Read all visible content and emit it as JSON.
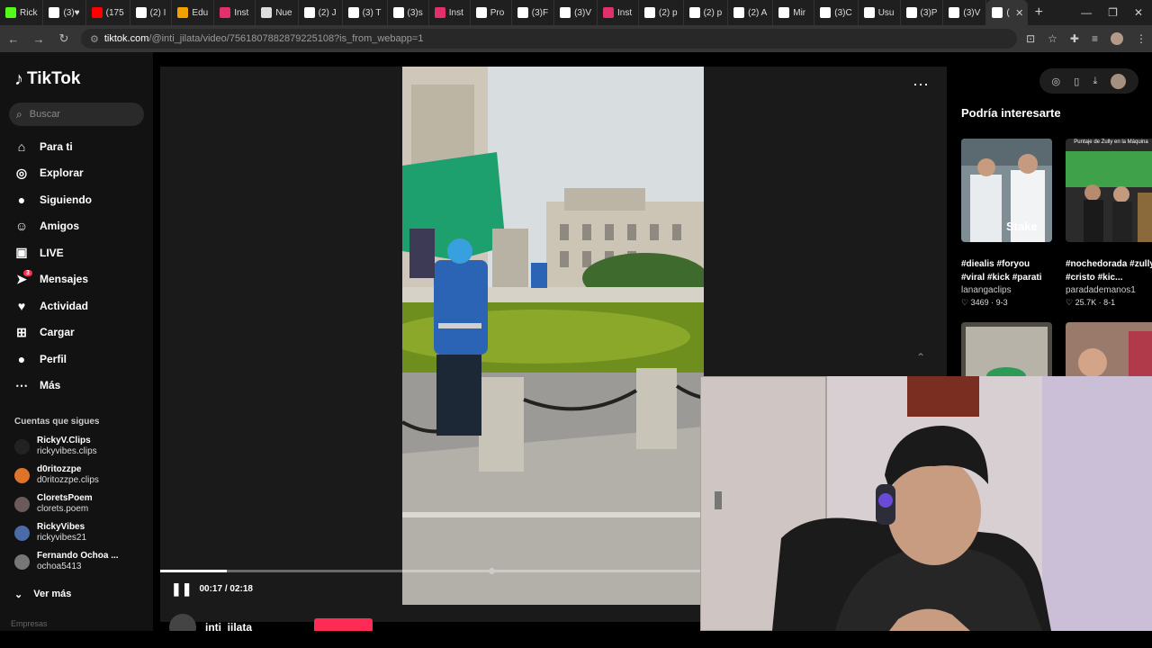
{
  "browser": {
    "tabs": [
      {
        "label": "Rick",
        "color": "#53fc18"
      },
      {
        "label": "(3)♥",
        "color": "#ffffff"
      },
      {
        "label": "(175",
        "color": "#ff0000"
      },
      {
        "label": "(2) I",
        "color": "#ffffff"
      },
      {
        "label": "Edu",
        "color": "#f4a100"
      },
      {
        "label": "Inst",
        "color": "#e1306c"
      },
      {
        "label": "Nue",
        "color": "#dddddd"
      },
      {
        "label": "(2) J",
        "color": "#ffffff"
      },
      {
        "label": "(3) T",
        "color": "#ffffff"
      },
      {
        "label": "(3)s",
        "color": "#ffffff"
      },
      {
        "label": "Inst",
        "color": "#e1306c"
      },
      {
        "label": "Pro",
        "color": "#ffffff"
      },
      {
        "label": "(3)F",
        "color": "#ffffff"
      },
      {
        "label": "(3)V",
        "color": "#ffffff"
      },
      {
        "label": "Inst",
        "color": "#e1306c"
      },
      {
        "label": "(2) p",
        "color": "#ffffff"
      },
      {
        "label": "(2) p",
        "color": "#ffffff"
      },
      {
        "label": "(2) A",
        "color": "#ffffff"
      },
      {
        "label": "Mir",
        "color": "#ffffff"
      },
      {
        "label": "(3)C",
        "color": "#ffffff"
      },
      {
        "label": "Usu",
        "color": "#ffffff"
      },
      {
        "label": "(3)P",
        "color": "#ffffff"
      },
      {
        "label": "(3)V",
        "color": "#ffffff"
      },
      {
        "label": "(",
        "color": "#ffffff",
        "active": true
      }
    ],
    "url_domain": "tiktok.com",
    "url_path": "/@inti_jilata/video/7561807882879225108?is_from_webapp=1"
  },
  "sidebar": {
    "logo": "TikTok",
    "search_placeholder": "Buscar",
    "nav": [
      {
        "label": "Para ti",
        "icon": "home-icon",
        "glyph": "⌂"
      },
      {
        "label": "Explorar",
        "icon": "compass-icon",
        "glyph": "◎"
      },
      {
        "label": "Siguiendo",
        "icon": "avatar-icon",
        "glyph": "●"
      },
      {
        "label": "Amigos",
        "icon": "friends-icon",
        "glyph": "☺"
      },
      {
        "label": "LIVE",
        "icon": "live-icon",
        "glyph": "▣"
      },
      {
        "label": "Mensajes",
        "icon": "messages-icon",
        "glyph": "➤",
        "badge": "3"
      },
      {
        "label": "Actividad",
        "icon": "activity-icon",
        "glyph": "♥"
      },
      {
        "label": "Cargar",
        "icon": "upload-icon",
        "glyph": "⊞"
      },
      {
        "label": "Perfil",
        "icon": "profile-icon",
        "glyph": "●"
      },
      {
        "label": "Más",
        "icon": "more-icon",
        "glyph": "⋯"
      }
    ],
    "following_title": "Cuentas que sigues",
    "following": [
      {
        "name": "RickyV.Clips",
        "handle": "rickyvibes.clips",
        "color": "#222222"
      },
      {
        "name": "d0ritozzpe",
        "handle": "d0ritozzpe.clips",
        "color": "#e0732a"
      },
      {
        "name": "CloretsPoem",
        "handle": "clorets.poem",
        "color": "#6a5a5a"
      },
      {
        "name": "RickyVibes",
        "handle": "rickyvibes21",
        "color": "#4a6aa8"
      },
      {
        "name": "Fernando Ochoa ...",
        "handle": "ochoa5413",
        "color": "#777777"
      }
    ],
    "see_more": "Ver más",
    "footer": "Empresas"
  },
  "player": {
    "time": "00:17 / 02:18",
    "progress": 0.123,
    "author": "inti_jilata"
  },
  "rail": {
    "title": "Podría interesarte",
    "cards": [
      {
        "caption": "#diealis #foryou #viral #kick #parati",
        "user": "lanangaclips",
        "stats": "♡ 3469 · 9-3"
      },
      {
        "caption": "#nochedorada #zully #cristo #kic...",
        "user": "paradademanos1",
        "stats": "♡ 25.7K · 8-1"
      }
    ],
    "card2_overlay": "Puntaje de Zully en la Máquina"
  }
}
